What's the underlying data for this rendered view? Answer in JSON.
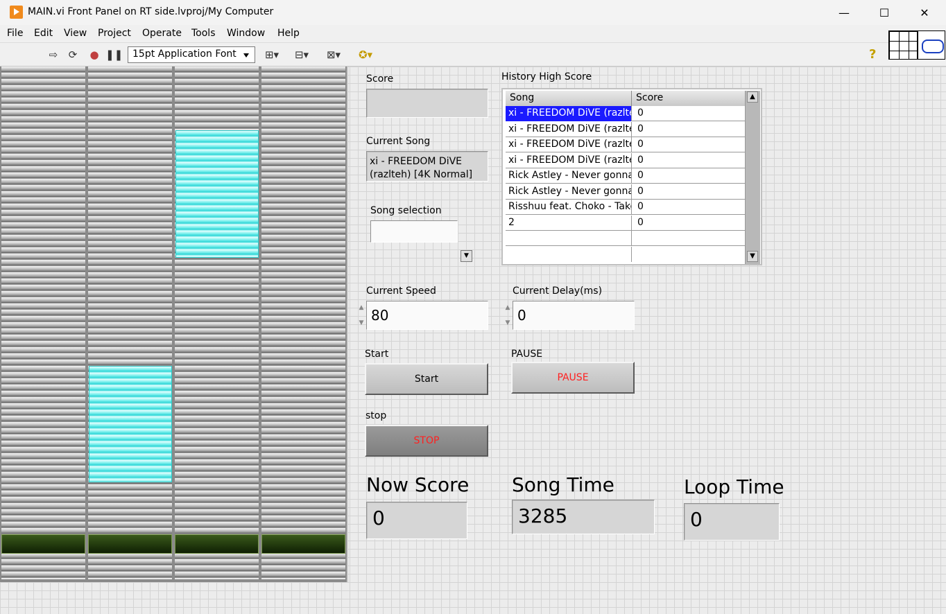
{
  "window": {
    "title": "MAIN.vi Front Panel on RT side.lvproj/My Computer",
    "minimize": "—",
    "maximize": "☐",
    "close": "✕"
  },
  "menu": [
    "File",
    "Edit",
    "View",
    "Project",
    "Operate",
    "Tools",
    "Window",
    "Help"
  ],
  "toolbar": {
    "font": "15pt Application Font",
    "help": "?"
  },
  "labels": {
    "score": "Score",
    "current_song": "Current Song",
    "song_selection": "Song selection",
    "history": "History High Score",
    "current_speed": "Current Speed",
    "current_delay": "Current Delay(ms)",
    "start": "Start",
    "pause": "PAUSE",
    "stop": "stop",
    "now_score": "Now Score",
    "song_time": "Song Time",
    "loop_time": "Loop Time"
  },
  "values": {
    "score": "",
    "current_song": "xi - FREEDOM DiVE (razlteh) [4K Normal]",
    "song_selection": "",
    "current_speed": "80",
    "current_delay": "0",
    "now_score": "0",
    "song_time": "3285",
    "loop_time": "0"
  },
  "buttons": {
    "start": "Start",
    "pause": "PAUSE",
    "stop": "STOP"
  },
  "history_table": {
    "columns": [
      "Song",
      "Score"
    ],
    "rows": [
      [
        "xi - FREEDOM DiVE (razlteh",
        "0"
      ],
      [
        "xi - FREEDOM DiVE (razlteh",
        "0"
      ],
      [
        "xi - FREEDOM DiVE (razlteh",
        "0"
      ],
      [
        "xi - FREEDOM DiVE (razlteh",
        "0"
      ],
      [
        "Rick Astley - Never gonna",
        "0"
      ],
      [
        "Rick Astley - Never gonna",
        "0"
      ],
      [
        "Risshuu feat. Choko - Take",
        "0"
      ],
      [
        "2",
        "0"
      ],
      [
        "",
        ""
      ],
      [
        "",
        ""
      ]
    ]
  },
  "colors": {
    "accent_text": "#ff2020",
    "selection": "#1a1aff",
    "note": "#2fd6d6"
  }
}
